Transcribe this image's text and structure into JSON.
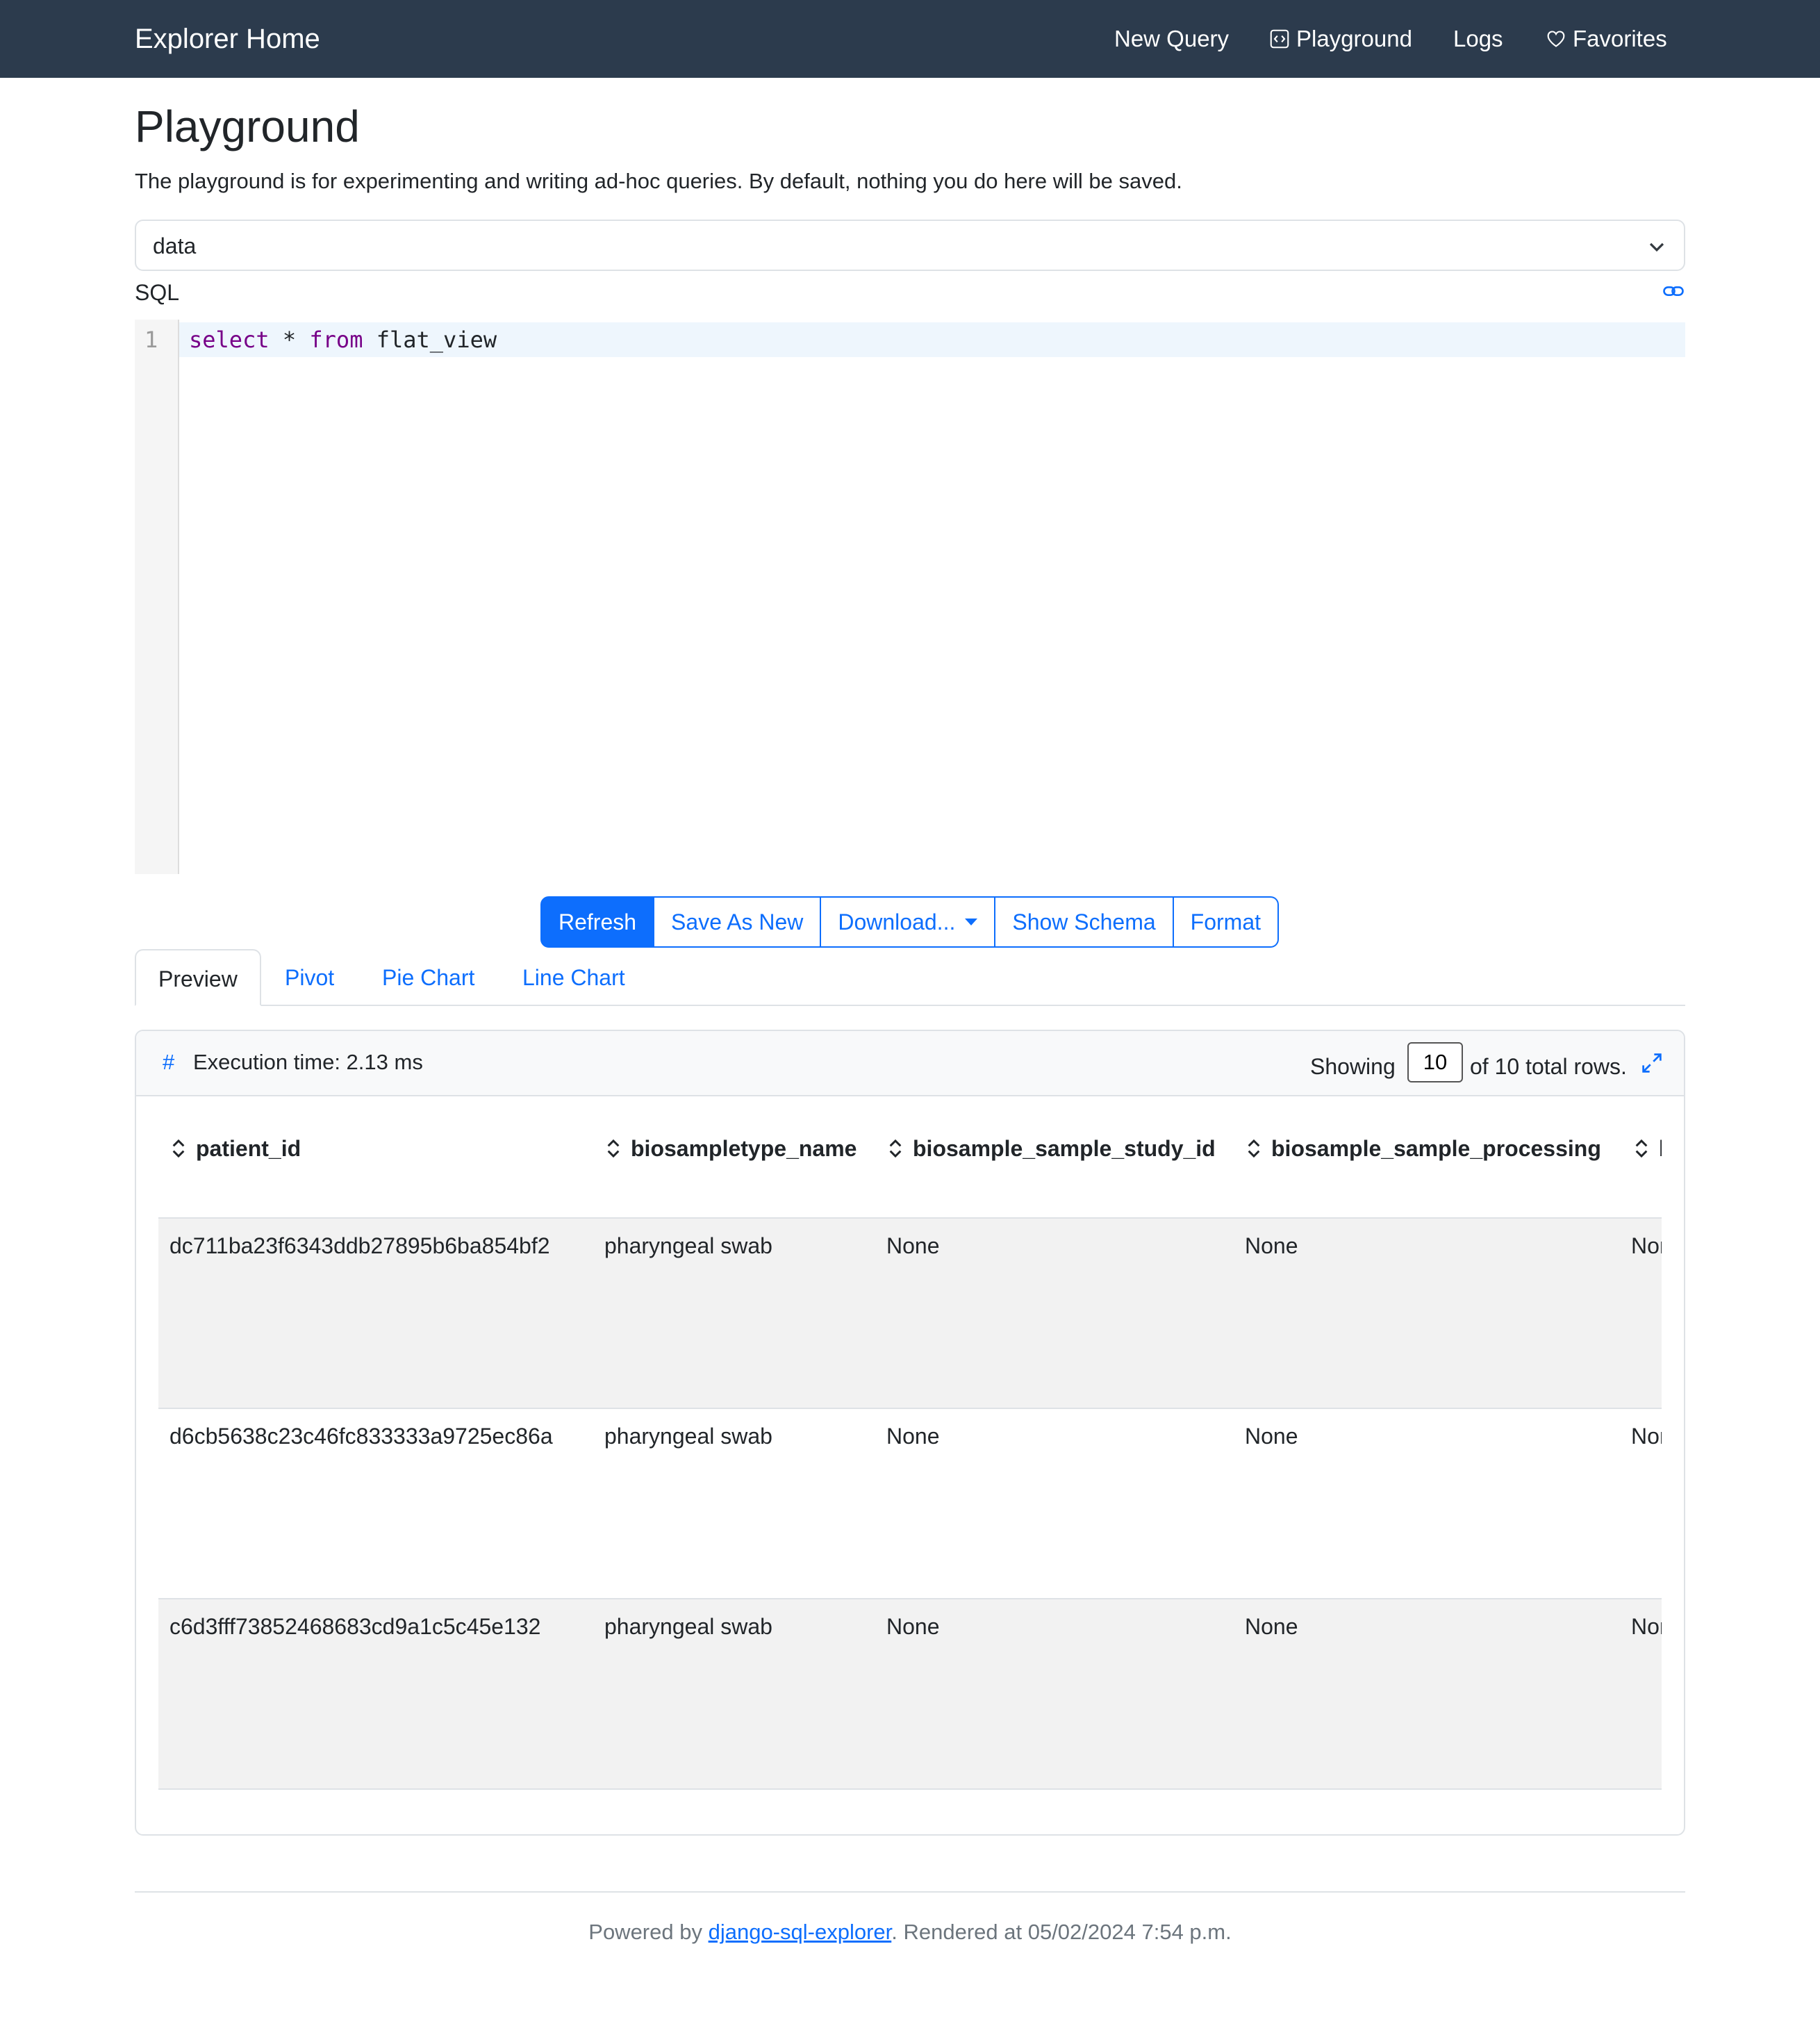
{
  "nav": {
    "brand": "Explorer Home",
    "links": [
      {
        "label": "New Query",
        "icon": ""
      },
      {
        "label": "Playground",
        "icon": "code-square-icon"
      },
      {
        "label": "Logs",
        "icon": ""
      },
      {
        "label": "Favorites",
        "icon": "heart-icon"
      }
    ]
  },
  "page": {
    "title": "Playground",
    "description": "The playground is for experimenting and writing ad-hoc queries. By default, nothing you do here will be saved."
  },
  "connection": {
    "selected": "data"
  },
  "editor": {
    "label": "SQL",
    "line_number": "1",
    "tokens": [
      {
        "text": "select",
        "kind": "keyword"
      },
      {
        "text": " * ",
        "kind": "plain"
      },
      {
        "text": "from",
        "kind": "keyword"
      },
      {
        "text": " flat_view",
        "kind": "plain"
      }
    ]
  },
  "actions": {
    "refresh": "Refresh",
    "save_as_new": "Save As New",
    "download": "Download...",
    "show_schema": "Show Schema",
    "format": "Format"
  },
  "tabs": [
    "Preview",
    "Pivot",
    "Pie Chart",
    "Line Chart"
  ],
  "results": {
    "hash": "#",
    "execution_time": "Execution time: 2.13 ms",
    "showing_label": "Showing",
    "rows_shown": "10",
    "total_label": "of 10 total rows.",
    "columns": [
      "patient_id",
      "biosampletype_name",
      "biosample_sample_study_id",
      "biosample_sample_processing",
      "b"
    ],
    "rows": [
      [
        "dc711ba23f6343ddb27895b6ba854bf2",
        "pharyngeal swab",
        "None",
        "None",
        "None"
      ],
      [
        "d6cb5638c23c46fc833333a9725ec86a",
        "pharyngeal swab",
        "None",
        "None",
        "None"
      ],
      [
        "c6d3fff73852468683cd9a1c5c45e132",
        "pharyngeal swab",
        "None",
        "None",
        "None"
      ]
    ]
  },
  "footer": {
    "prefix": "Powered by ",
    "link": "django-sql-explorer",
    "suffix": ". Rendered at 05/02/2024 7:54 p.m."
  },
  "colors": {
    "navbar": "#2c3b4d",
    "primary": "#0d6efd",
    "keyword": "#770088",
    "row_stripe": "#f2f2f2"
  }
}
